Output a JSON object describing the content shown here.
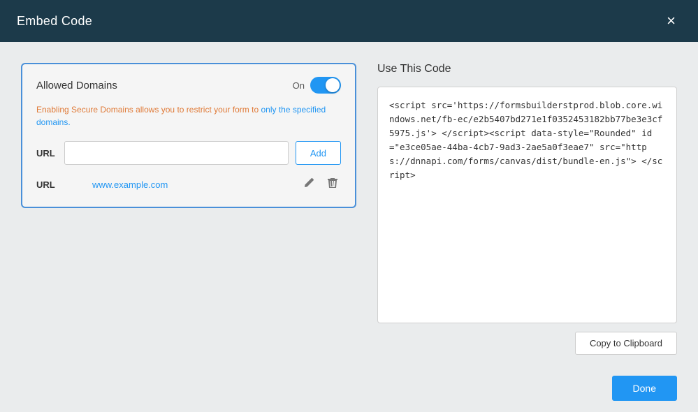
{
  "header": {
    "title": "Embed Code",
    "close_label": "×"
  },
  "left": {
    "box_title": "Allowed Domains",
    "toggle_label": "On",
    "help_text": "Enabling Secure Domains allows you to restrict your form to only the specified domains.",
    "url_label": "URL",
    "url_placeholder": "",
    "add_button_label": "Add",
    "url_entry_label": "URL",
    "url_entry_value": "www.example.com"
  },
  "right": {
    "section_title": "Use This Code",
    "code": "<script\nsrc='https://formsbuilderstprod.blob.core.windows.net/fb-ec/e2b5407bd271e1f0352453182bb77be3e3cf5975.js'>\n</script><script data-style=\"Rounded\" id=\"e3ce05ae-44ba-4cb7-9ad3-2ae5a0f3eae7\"\nsrc=\"https://dnnapi.com/forms/canvas/dist/bundle-en.js\">\n</script>",
    "copy_button_label": "Copy to Clipboard"
  },
  "footer": {
    "done_label": "Done"
  }
}
